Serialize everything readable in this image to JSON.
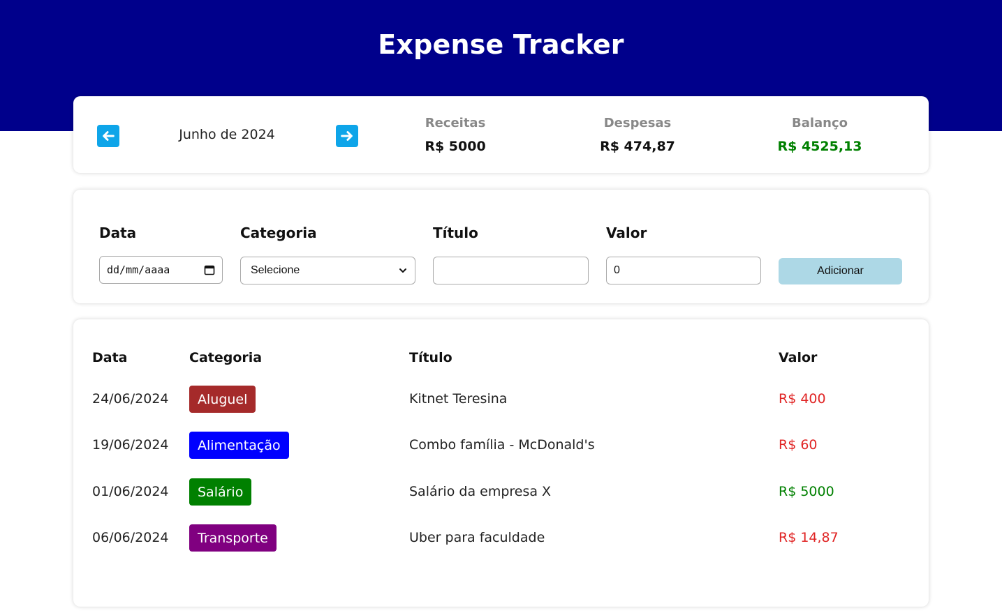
{
  "header": {
    "title": "Expense Tracker",
    "bg_color": "#00008b"
  },
  "info": {
    "month": "Junho de 2024",
    "prev_icon": "arrow-left-icon",
    "next_icon": "arrow-right-icon",
    "receitas_label": "Receitas",
    "receitas_value": "R$ 5000",
    "despesas_label": "Despesas",
    "despesas_value": "R$ 474,87",
    "balanco_label": "Balanço",
    "balanco_value": "R$ 4525,13"
  },
  "form": {
    "data_label": "Data",
    "data_placeholder": "dd/mm/aaaa",
    "categoria_label": "Categoria",
    "categoria_selected": "Selecione",
    "titulo_label": "Título",
    "titulo_value": "",
    "valor_label": "Valor",
    "valor_value": "0",
    "add_label": "Adicionar"
  },
  "table": {
    "headers": {
      "data": "Data",
      "categoria": "Categoria",
      "titulo": "Título",
      "valor": "Valor"
    },
    "rows": [
      {
        "data": "24/06/2024",
        "categoria": "Aluguel",
        "titulo": "Kitnet Teresina",
        "valor": "R$ 400"
      },
      {
        "data": "19/06/2024",
        "categoria": "Alimentação",
        "titulo": "Combo família - McDonald's",
        "valor": "R$ 60"
      },
      {
        "data": "01/06/2024",
        "categoria": "Salário",
        "titulo": "Salário da empresa X",
        "valor": "R$ 5000"
      },
      {
        "data": "06/06/2024",
        "categoria": "Transporte",
        "titulo": "Uber para faculdade",
        "valor": "R$ 14,87"
      }
    ]
  },
  "colors": {
    "aluguel": "#a52a2a",
    "alimentacao": "#0000ff",
    "salario": "#008000",
    "transporte": "#800080",
    "expense": "#e02424",
    "income": "#008000"
  }
}
